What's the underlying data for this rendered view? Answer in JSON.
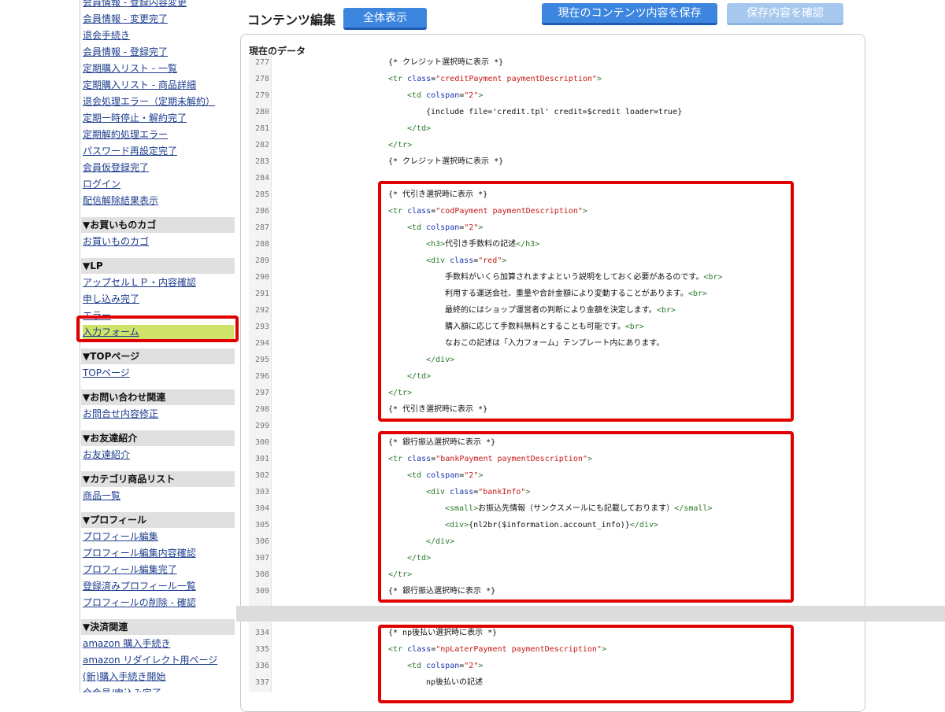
{
  "sidebar": {
    "items": [
      {
        "label": "会員情報 - 登録内容変更",
        "kind": "link"
      },
      {
        "label": "会員情報 - 変更完了",
        "kind": "link"
      },
      {
        "label": "退会手続き",
        "kind": "link"
      },
      {
        "label": "会員情報 - 登録完了",
        "kind": "link"
      },
      {
        "label": "定期購入リスト - 一覧",
        "kind": "link"
      },
      {
        "label": "定期購入リスト - 商品詳細",
        "kind": "link"
      },
      {
        "label": "退会処理エラー（定期未解約）",
        "kind": "link"
      },
      {
        "label": "定期一時停止・解約完了",
        "kind": "link"
      },
      {
        "label": "定期解約処理エラー",
        "kind": "link"
      },
      {
        "label": "パスワード再設定完了",
        "kind": "link"
      },
      {
        "label": "会員仮登録完了",
        "kind": "link"
      },
      {
        "label": "ログイン",
        "kind": "link"
      },
      {
        "label": "配信解除結果表示",
        "kind": "link"
      },
      {
        "label": "▼お買いものカゴ",
        "kind": "head"
      },
      {
        "label": "お買いものカゴ",
        "kind": "link"
      },
      {
        "label": "▼LP",
        "kind": "head"
      },
      {
        "label": "アップセルＬＰ・内容確認",
        "kind": "link"
      },
      {
        "label": "申し込み完了",
        "kind": "link"
      },
      {
        "label": "エラー",
        "kind": "link"
      },
      {
        "label": "入力フォーム",
        "kind": "link",
        "highlight": true
      },
      {
        "label": "▼TOPページ",
        "kind": "head"
      },
      {
        "label": "TOPページ",
        "kind": "link"
      },
      {
        "label": "▼お問い合わせ関連",
        "kind": "head"
      },
      {
        "label": "お問合せ内容修正",
        "kind": "link"
      },
      {
        "label": "▼お友達紹介",
        "kind": "head"
      },
      {
        "label": "お友達紹介",
        "kind": "link"
      },
      {
        "label": "▼カテゴリ商品リスト",
        "kind": "head"
      },
      {
        "label": "商品一覧",
        "kind": "link"
      },
      {
        "label": "▼プロフィール",
        "kind": "head"
      },
      {
        "label": "プロフィール編集",
        "kind": "link"
      },
      {
        "label": "プロフィール編集内容確認",
        "kind": "link"
      },
      {
        "label": "プロフィール編集完了",
        "kind": "link"
      },
      {
        "label": "登録済みプロフィール一覧",
        "kind": "link"
      },
      {
        "label": "プロフィールの削除 - 確認",
        "kind": "link"
      },
      {
        "label": "▼決済関連",
        "kind": "head"
      },
      {
        "label": "amazon 購入手続き",
        "kind": "link"
      },
      {
        "label": "amazon リダイレクト用ページ",
        "kind": "link"
      },
      {
        "label": "(新)購入手続き開始",
        "kind": "link"
      },
      {
        "label": "全会員/申込み完了",
        "kind": "link"
      }
    ]
  },
  "header": {
    "title": "コンテンツ編集",
    "show_all_label": "全体表示",
    "save_label": "現在のコンテンツ内容を保存",
    "confirm_label": "保存内容を確認"
  },
  "editor": {
    "label": "現在のデータ",
    "lines": [
      {
        "n": "277",
        "indent": 0,
        "parts": [
          {
            "t": "{* クレジット選択時に表示 *}",
            "c": "txt"
          }
        ]
      },
      {
        "n": "278",
        "indent": 0,
        "parts": [
          {
            "t": "<tr ",
            "c": "tag"
          },
          {
            "t": "class",
            "c": "attr"
          },
          {
            "t": "=",
            "c": "txt"
          },
          {
            "t": "\"creditPayment paymentDescription\"",
            "c": "str"
          },
          {
            "t": ">",
            "c": "tag"
          }
        ]
      },
      {
        "n": "279",
        "indent": 1,
        "parts": [
          {
            "t": "<td ",
            "c": "tag"
          },
          {
            "t": "colspan",
            "c": "attr"
          },
          {
            "t": "=",
            "c": "txt"
          },
          {
            "t": "\"2\"",
            "c": "str"
          },
          {
            "t": ">",
            "c": "tag"
          }
        ]
      },
      {
        "n": "280",
        "indent": 2,
        "parts": [
          {
            "t": "{include file='credit.tpl' credit=$credit loader=true}",
            "c": "txt"
          }
        ]
      },
      {
        "n": "281",
        "indent": 1,
        "parts": [
          {
            "t": "</td>",
            "c": "tag"
          }
        ]
      },
      {
        "n": "282",
        "indent": 0,
        "parts": [
          {
            "t": "</tr>",
            "c": "tag"
          }
        ]
      },
      {
        "n": "283",
        "indent": 0,
        "parts": [
          {
            "t": "{* クレジット選択時に表示 *}",
            "c": "txt"
          }
        ]
      },
      {
        "n": "284",
        "indent": 0,
        "parts": []
      },
      {
        "n": "285",
        "indent": 0,
        "parts": [
          {
            "t": "{* 代引き選択時に表示 *}",
            "c": "txt"
          }
        ]
      },
      {
        "n": "286",
        "indent": 0,
        "parts": [
          {
            "t": "<tr ",
            "c": "tag"
          },
          {
            "t": "class",
            "c": "attr"
          },
          {
            "t": "=",
            "c": "txt"
          },
          {
            "t": "\"codPayment paymentDescription\"",
            "c": "str"
          },
          {
            "t": ">",
            "c": "tag"
          }
        ]
      },
      {
        "n": "287",
        "indent": 1,
        "parts": [
          {
            "t": "<td ",
            "c": "tag"
          },
          {
            "t": "colspan",
            "c": "attr"
          },
          {
            "t": "=",
            "c": "txt"
          },
          {
            "t": "\"2\"",
            "c": "str"
          },
          {
            "t": ">",
            "c": "tag"
          }
        ]
      },
      {
        "n": "288",
        "indent": 2,
        "parts": [
          {
            "t": "<h3>",
            "c": "tag"
          },
          {
            "t": "代引き手数料の記述",
            "c": "txt"
          },
          {
            "t": "</h3>",
            "c": "tag"
          }
        ]
      },
      {
        "n": "289",
        "indent": 2,
        "parts": [
          {
            "t": "<div ",
            "c": "tag"
          },
          {
            "t": "class",
            "c": "attr"
          },
          {
            "t": "=",
            "c": "txt"
          },
          {
            "t": "\"red\"",
            "c": "str"
          },
          {
            "t": ">",
            "c": "tag"
          }
        ]
      },
      {
        "n": "290",
        "indent": 3,
        "parts": [
          {
            "t": "手数料がいくら加算されますよという説明をしておく必要があるのです。",
            "c": "txt"
          },
          {
            "t": "<br>",
            "c": "tag"
          }
        ]
      },
      {
        "n": "291",
        "indent": 3,
        "parts": [
          {
            "t": "利用する運送会社、重量や合計金額により変動することがあります。",
            "c": "txt"
          },
          {
            "t": "<br>",
            "c": "tag"
          }
        ]
      },
      {
        "n": "292",
        "indent": 3,
        "parts": [
          {
            "t": "最終的にはショップ運営者の判断により金額を決定します。",
            "c": "txt"
          },
          {
            "t": "<br>",
            "c": "tag"
          }
        ]
      },
      {
        "n": "293",
        "indent": 3,
        "parts": [
          {
            "t": "購入額に応じて手数料無料とすることも可能です。",
            "c": "txt"
          },
          {
            "t": "<br>",
            "c": "tag"
          }
        ]
      },
      {
        "n": "294",
        "indent": 3,
        "parts": [
          {
            "t": "なおこの記述は「入力フォーム」テンプレート内にあります。",
            "c": "txt"
          }
        ]
      },
      {
        "n": "295",
        "indent": 2,
        "parts": [
          {
            "t": "</div>",
            "c": "tag"
          }
        ]
      },
      {
        "n": "296",
        "indent": 1,
        "parts": [
          {
            "t": "</td>",
            "c": "tag"
          }
        ]
      },
      {
        "n": "297",
        "indent": 0,
        "parts": [
          {
            "t": "</tr>",
            "c": "tag"
          }
        ]
      },
      {
        "n": "298",
        "indent": 0,
        "parts": [
          {
            "t": "{* 代引き選択時に表示 *}",
            "c": "txt"
          }
        ]
      },
      {
        "n": "299",
        "indent": 0,
        "parts": []
      },
      {
        "n": "300",
        "indent": 0,
        "parts": [
          {
            "t": "{* 銀行振込選択時に表示 *}",
            "c": "txt"
          }
        ]
      },
      {
        "n": "301",
        "indent": 0,
        "parts": [
          {
            "t": "<tr ",
            "c": "tag"
          },
          {
            "t": "class",
            "c": "attr"
          },
          {
            "t": "=",
            "c": "txt"
          },
          {
            "t": "\"bankPayment paymentDescription\"",
            "c": "str"
          },
          {
            "t": ">",
            "c": "tag"
          }
        ]
      },
      {
        "n": "302",
        "indent": 1,
        "parts": [
          {
            "t": "<td ",
            "c": "tag"
          },
          {
            "t": "colspan",
            "c": "attr"
          },
          {
            "t": "=",
            "c": "txt"
          },
          {
            "t": "\"2\"",
            "c": "str"
          },
          {
            "t": ">",
            "c": "tag"
          }
        ]
      },
      {
        "n": "303",
        "indent": 2,
        "parts": [
          {
            "t": "<div ",
            "c": "tag"
          },
          {
            "t": "class",
            "c": "attr"
          },
          {
            "t": "=",
            "c": "txt"
          },
          {
            "t": "\"bankInfo\"",
            "c": "str"
          },
          {
            "t": ">",
            "c": "tag"
          }
        ]
      },
      {
        "n": "304",
        "indent": 3,
        "parts": [
          {
            "t": "<small>",
            "c": "tag"
          },
          {
            "t": "お振込先情報（サンクスメールにも記載しております）",
            "c": "txt"
          },
          {
            "t": "</small>",
            "c": "tag"
          }
        ]
      },
      {
        "n": "305",
        "indent": 3,
        "parts": [
          {
            "t": "<div>",
            "c": "tag"
          },
          {
            "t": "{nl2br($information.account_info)}",
            "c": "txt"
          },
          {
            "t": "</div>",
            "c": "tag"
          }
        ]
      },
      {
        "n": "306",
        "indent": 2,
        "parts": [
          {
            "t": "</div>",
            "c": "tag"
          }
        ]
      },
      {
        "n": "307",
        "indent": 1,
        "parts": [
          {
            "t": "</td>",
            "c": "tag"
          }
        ]
      },
      {
        "n": "308",
        "indent": 0,
        "parts": [
          {
            "t": "</tr>",
            "c": "tag"
          }
        ]
      },
      {
        "n": "309",
        "indent": 0,
        "parts": [
          {
            "t": "{* 銀行振込選択時に表示 *}",
            "c": "txt"
          }
        ]
      },
      {
        "n": "334",
        "indent": 0,
        "parts": [
          {
            "t": "{* np後払い選択時に表示 *}",
            "c": "txt"
          }
        ]
      },
      {
        "n": "335",
        "indent": 0,
        "parts": [
          {
            "t": "<tr ",
            "c": "tag"
          },
          {
            "t": "class",
            "c": "attr"
          },
          {
            "t": "=",
            "c": "txt"
          },
          {
            "t": "\"npLaterPayment paymentDescription\"",
            "c": "str"
          },
          {
            "t": ">",
            "c": "tag"
          }
        ]
      },
      {
        "n": "336",
        "indent": 1,
        "parts": [
          {
            "t": "<td ",
            "c": "tag"
          },
          {
            "t": "colspan",
            "c": "attr"
          },
          {
            "t": "=",
            "c": "txt"
          },
          {
            "t": "\"2\"",
            "c": "str"
          },
          {
            "t": ">",
            "c": "tag"
          }
        ]
      },
      {
        "n": "337",
        "indent": 2,
        "parts": [
          {
            "t": "np後払いの記述",
            "c": "txt"
          }
        ]
      }
    ]
  },
  "colors": {
    "link": "#1c3c8c",
    "highlight": "#cfe368",
    "annotation_red": "#e00000",
    "button_blue": "#3d86e0",
    "tag_green": "#2a7a2a",
    "attr_blue": "#1a35b0",
    "string_red": "#c41a16"
  }
}
